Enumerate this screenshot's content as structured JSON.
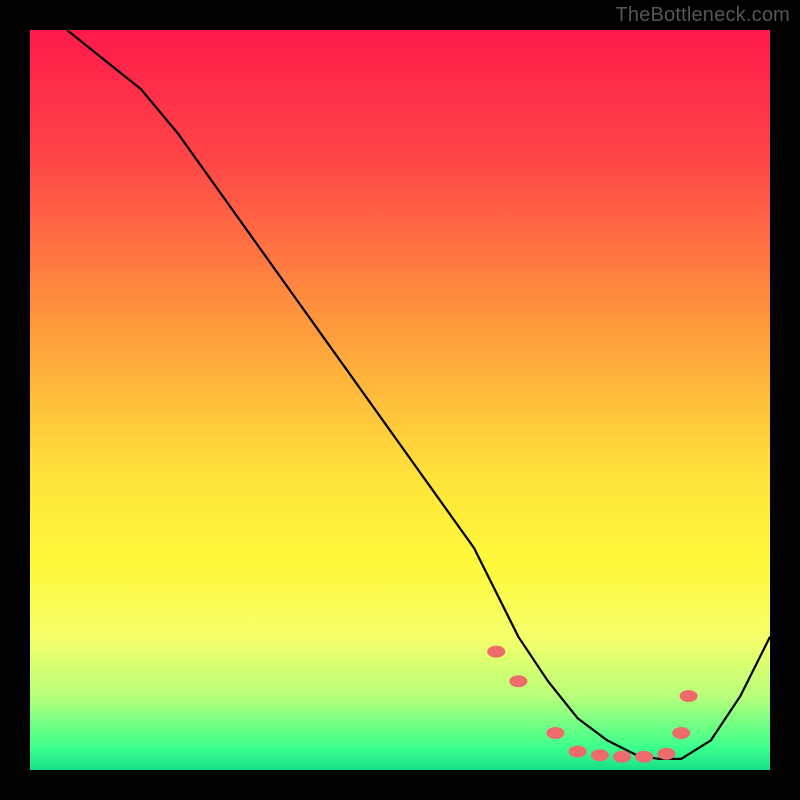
{
  "watermark": "TheBottleneck.com",
  "chart_data": {
    "type": "line",
    "title": "",
    "xlabel": "",
    "ylabel": "",
    "xlim": [
      0,
      100
    ],
    "ylim": [
      0,
      100
    ],
    "grid": false,
    "legend": false,
    "background": "heatmap-vertical-gradient",
    "gradient_stops": [
      {
        "pos": 0.0,
        "color": "#ff1a4b"
      },
      {
        "pos": 0.18,
        "color": "#ff4747"
      },
      {
        "pos": 0.4,
        "color": "#ff9a3c"
      },
      {
        "pos": 0.6,
        "color": "#ffe23a"
      },
      {
        "pos": 0.72,
        "color": "#fff93a"
      },
      {
        "pos": 0.82,
        "color": "#f6ff6a"
      },
      {
        "pos": 0.9,
        "color": "#b8ff7a"
      },
      {
        "pos": 0.97,
        "color": "#3bff8c"
      },
      {
        "pos": 1.0,
        "color": "#18e08a"
      }
    ],
    "series": [
      {
        "name": "curve",
        "color": "#000000",
        "x": [
          5,
          10,
          15,
          20,
          25,
          30,
          35,
          40,
          45,
          50,
          55,
          60,
          63,
          66,
          70,
          74,
          78,
          82,
          85,
          88,
          92,
          96,
          100
        ],
        "y": [
          100,
          96,
          92,
          86,
          79,
          72,
          65,
          58,
          51,
          44,
          37,
          30,
          24,
          18,
          12,
          7,
          4,
          2,
          1.5,
          1.5,
          4,
          10,
          18
        ]
      }
    ],
    "markers": {
      "name": "highlight-points",
      "color": "#ef6b6b",
      "shape": "oval",
      "x": [
        63,
        66,
        71,
        74,
        77,
        80,
        83,
        86,
        88,
        89
      ],
      "y": [
        16,
        12,
        5,
        2.5,
        2,
        1.8,
        1.8,
        2.2,
        5,
        10
      ]
    }
  }
}
